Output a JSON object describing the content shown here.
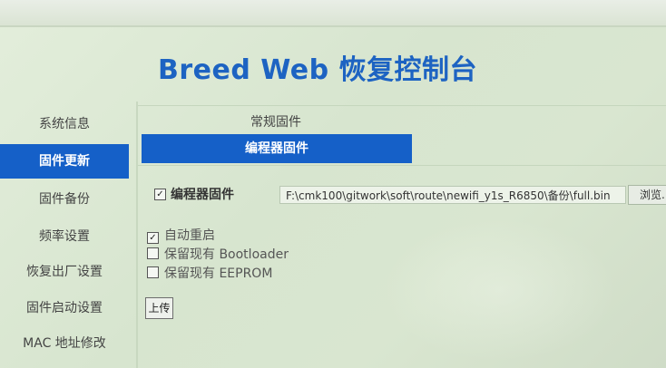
{
  "page": {
    "title": "Breed Web 恢复控制台"
  },
  "sidebar": {
    "items": [
      {
        "label": "系统信息",
        "active": false
      },
      {
        "label": "固件更新",
        "active": true
      },
      {
        "label": "固件备份",
        "active": false
      },
      {
        "label": "频率设置",
        "active": false
      },
      {
        "label": "恢复出厂设置",
        "active": false
      },
      {
        "label": "固件启动设置",
        "active": false
      },
      {
        "label": "MAC 地址修改",
        "active": false
      }
    ]
  },
  "tabs": {
    "normal_firmware": "常规固件",
    "programmer_firmware": "编程器固件"
  },
  "form": {
    "firmware_checkbox": {
      "label": "编程器固件",
      "checked": true
    },
    "file_path": "F:\\cmk100\\gitwork\\soft\\route\\newifi_y1s_R6850\\备份\\full.bin",
    "browse_label": "浏览...",
    "options": [
      {
        "label": "自动重启",
        "checked": true
      },
      {
        "label": "保留现有 Bootloader",
        "checked": false
      },
      {
        "label": "保留现有 EEPROM",
        "checked": false
      }
    ],
    "upload_label": "上传"
  },
  "colors": {
    "accent": "#1560c8",
    "title": "#1d63c2",
    "background": "#dbe8d2"
  }
}
